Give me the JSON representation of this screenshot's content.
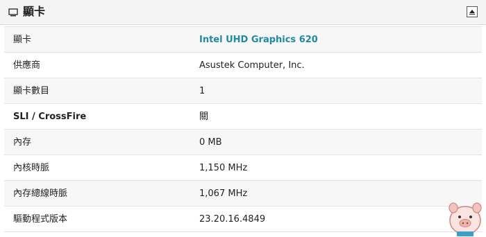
{
  "panel": {
    "title": "顯卡",
    "icon": "monitor-icon",
    "collapse_icon": "collapse-up-icon"
  },
  "rows": [
    {
      "label": "顯卡",
      "value": "Intel UHD Graphics 620",
      "value_is_link": true
    },
    {
      "label": "供應商",
      "value": "Asustek Computer, Inc."
    },
    {
      "label": "顯卡數目",
      "value": "1"
    },
    {
      "label": "SLI / CrossFire",
      "value": "關",
      "label_bold": true
    },
    {
      "label": "內存",
      "value": "0 MB"
    },
    {
      "label": "內核時脈",
      "value": "1,150 MHz"
    },
    {
      "label": "內存總線時脈",
      "value": "1,067 MHz"
    },
    {
      "label": "驅動程式版本",
      "value": "23.20.16.4849"
    }
  ],
  "colors": {
    "link": "#1f8aa0",
    "header_bg": "#f4f4f4",
    "row_alt": "#f7f7f7"
  },
  "mascot": {
    "icon": "pig-mascot-icon"
  }
}
